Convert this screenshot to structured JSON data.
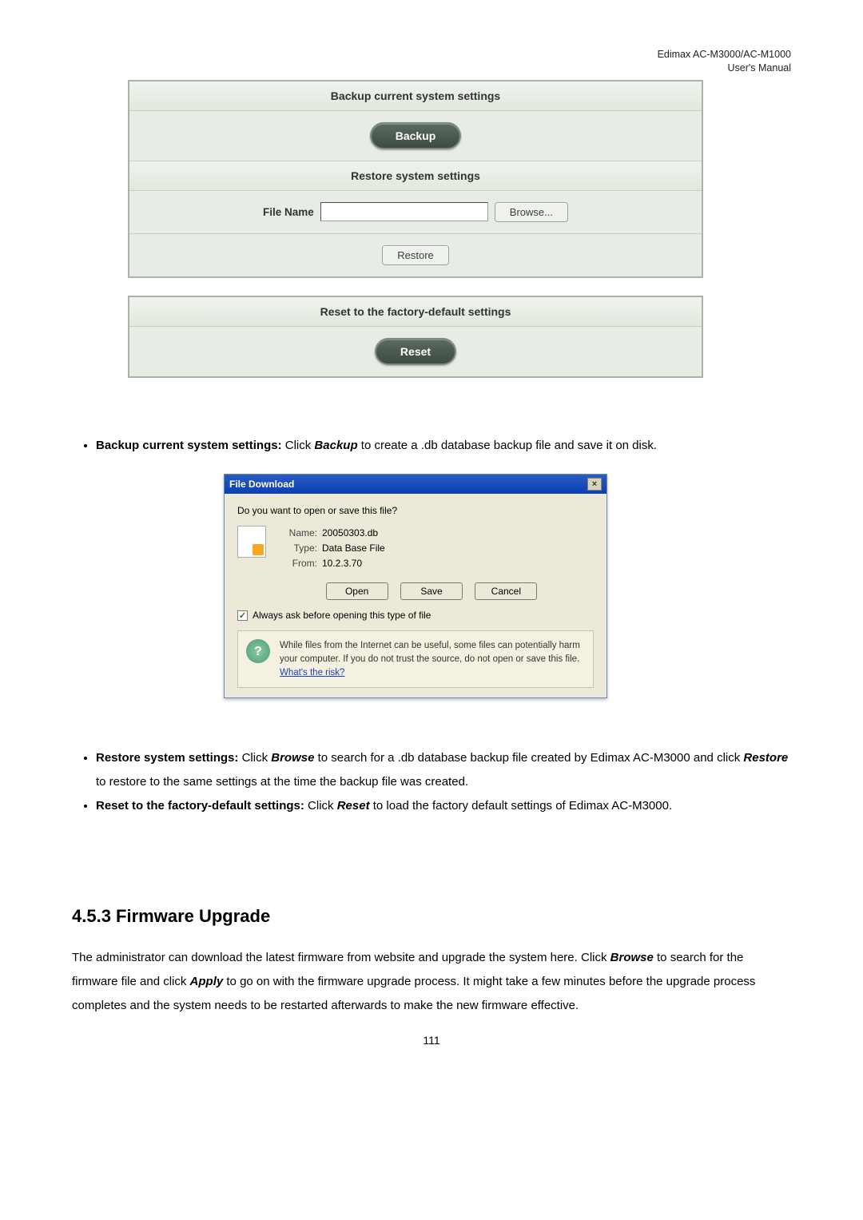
{
  "header": {
    "line1": "Edimax  AC-M3000/AC-M1000",
    "line2": "User's  Manual"
  },
  "panel1": {
    "backup_title": "Backup current system settings",
    "backup_btn": "Backup",
    "restore_title": "Restore system settings",
    "file_label": "File Name",
    "browse_btn": "Browse...",
    "restore_btn": "Restore",
    "reset_title": "Reset to the factory-default settings",
    "reset_btn": "Reset"
  },
  "bullet1": {
    "lead": "Backup current system settings:",
    "verb": "Backup",
    "rest_a": " Click ",
    "rest_b": " to create a .db database backup file and save it on disk."
  },
  "dialog": {
    "title": "File Download",
    "close": "×",
    "question": "Do you want to open or save this file?",
    "name_lbl": "Name:",
    "name_val": "20050303.db",
    "type_lbl": "Type:",
    "type_val": "Data Base File",
    "from_lbl": "From:",
    "from_val": "10.2.3.70",
    "btn_open": "Open",
    "btn_save": "Save",
    "btn_cancel": "Cancel",
    "checkbox_label": "Always ask before opening this type of file",
    "warn_text": "While files from the Internet can be useful, some files can potentially harm your computer. If you do not trust the source, do not open or save this file. ",
    "warn_link": "What's the risk?"
  },
  "bullet2": {
    "restore_lead": "Restore system settings:",
    "r_a": " Click ",
    "r_browse": "Browse",
    "r_b": " to search for a .db database backup file created by Edimax AC-M3000 and click ",
    "r_restore": "Restore",
    "r_c": " to restore to the same settings at the time the backup file was created.",
    "reset_lead": "Reset to the factory-default settings:",
    "rs_a": " Click ",
    "rs_reset": "Reset",
    "rs_b": " to load the factory default settings of Edimax AC-M3000."
  },
  "section": {
    "title": "4.5.3 Firmware Upgrade",
    "p_a": "The administrator can download the latest firmware from website and upgrade the system here. Click ",
    "p_browse": "Browse",
    "p_b": " to search for the firmware file and click ",
    "p_apply": "Apply",
    "p_c": " to go on with the firmware upgrade process. It might take a few minutes before the upgrade process completes and the system needs to be restarted afterwards to make the new firmware effective."
  },
  "page_num": "111"
}
